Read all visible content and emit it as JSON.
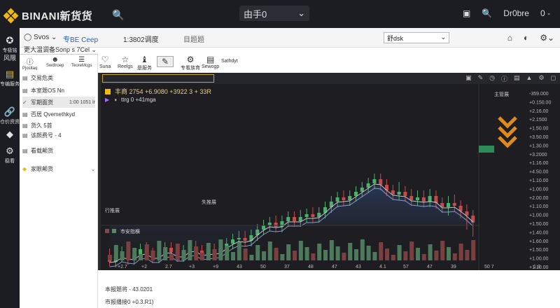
{
  "app": {
    "brand": "BINANI新货货",
    "search_icon": "search-icon",
    "center_select": "由手0",
    "right_items": [
      "Dr0bre",
      "0 -"
    ]
  },
  "rail": [
    {
      "label": "专极铭",
      "icon": "star-icon"
    },
    {
      "label": "风限",
      "icon": "chart-icon"
    },
    {
      "label": "专编服务",
      "icon": "book-icon"
    },
    {
      "label": "仓价资资",
      "icon": "link-icon"
    },
    {
      "label": "",
      "icon": "diamond-icon"
    },
    {
      "label": "稳看",
      "icon": "gear-icon"
    }
  ],
  "toolbar1": {
    "pair": "Svos",
    "market": "专BE Ceep",
    "stat1": "1:3802调度",
    "stat2": "目题题",
    "select_value": "舒dsk",
    "icons": [
      "home-icon",
      "theme-icon",
      "settings-icon",
      "chevron-down-icon"
    ]
  },
  "crumb": "更大温调备Sonp s 7Cel",
  "leftpanel": {
    "tabs": [
      "Pjosltaq",
      "Swdtroep",
      "TeoreMcgs"
    ],
    "items": [
      {
        "text": "交易危类",
        "value": ""
      },
      {
        "text": "本室题OS Nn",
        "value": ""
      },
      {
        "text": "军期面货",
        "value": "1:00 1051 lr"
      },
      {
        "text": "否居 Qvemethkyd",
        "value": ""
      },
      {
        "text": "货久 5首",
        "value": ""
      },
      {
        "text": "该颜费号 - 4",
        "value": ""
      },
      {
        "text": "看载颠货",
        "value": ""
      },
      {
        "text": "家眼颠货",
        "value": ""
      }
    ]
  },
  "toolbar2": [
    "Suna",
    "Reelgs",
    "是服务",
    "",
    "专看族育",
    "Sewogp",
    "Sathdyt"
  ],
  "chart": {
    "legend1": "丰商 2754 +6.9080 +3922 3 + 33R",
    "legend2": "ttrg 0 +41mga",
    "annotation1": "行推展",
    "annotation2": "失推展",
    "volume_label": "市安指横",
    "side_header": "主管展",
    "price_labels": [
      "-359.000",
      "+0.150.00",
      "+2.16.00",
      "+2.1500",
      "+1.50.00",
      "+3.50.00",
      "+1.30.00",
      "+3.2000",
      "+1.16.00",
      "+4.50.00",
      "+1.10.00",
      "+1.00.00",
      "+2.00.00",
      "+1.10.00",
      "+1.00.00",
      "+1.50.00",
      "+1.40.00",
      "+1.60.00",
      "+1.50.00",
      "+1.00.00",
      "+1.10.00"
    ],
    "x_labels": [
      "+2.7",
      "+2",
      "2.7",
      "+3",
      "+9",
      "43",
      "50",
      "37",
      "48",
      "47",
      "43",
      "4.1",
      "57",
      "47",
      "39"
    ],
    "x_right": [
      "50 7",
      "1 3"
    ]
  },
  "below": {
    "line1": "本报题将 - 43.0201",
    "line2": "市报播接0 +0.3.R1)"
  },
  "chart_data": {
    "type": "candlestick",
    "series": [
      {
        "values": [
          [
            264,
            270,
            255,
            272
          ],
          [
            270,
            262,
            260,
            274
          ],
          [
            262,
            258,
            252,
            266
          ],
          [
            258,
            266,
            254,
            270
          ],
          [
            266,
            260,
            256,
            270
          ],
          [
            260,
            252,
            248,
            264
          ],
          [
            252,
            258,
            246,
            262
          ],
          [
            258,
            264,
            254,
            268
          ],
          [
            264,
            258,
            254,
            268
          ],
          [
            258,
            250,
            246,
            262
          ],
          [
            250,
            256,
            246,
            260
          ],
          [
            256,
            262,
            252,
            266
          ],
          [
            262,
            256,
            250,
            266
          ],
          [
            256,
            248,
            244,
            260
          ],
          [
            248,
            254,
            244,
            258
          ],
          [
            254,
            260,
            250,
            264
          ],
          [
            260,
            252,
            248,
            264
          ],
          [
            252,
            258,
            248,
            262
          ],
          [
            258,
            250,
            246,
            262
          ],
          [
            250,
            244,
            240,
            254
          ],
          [
            244,
            238,
            234,
            248
          ],
          [
            238,
            236,
            230,
            242
          ],
          [
            236,
            240,
            230,
            244
          ],
          [
            240,
            232,
            228,
            244
          ],
          [
            232,
            224,
            220,
            236
          ],
          [
            224,
            218,
            214,
            228
          ],
          [
            218,
            214,
            210,
            222
          ],
          [
            214,
            220,
            208,
            224
          ],
          [
            220,
            212,
            208,
            224
          ],
          [
            212,
            206,
            202,
            216
          ],
          [
            206,
            212,
            202,
            216
          ],
          [
            212,
            206,
            200,
            216
          ],
          [
            206,
            202,
            198,
            210
          ],
          [
            202,
            206,
            196,
            210
          ],
          [
            206,
            200,
            196,
            210
          ],
          [
            200,
            192,
            188,
            204
          ],
          [
            192,
            184,
            180,
            196
          ],
          [
            184,
            178,
            174,
            188
          ],
          [
            178,
            182,
            172,
            186
          ],
          [
            182,
            176,
            172,
            186
          ],
          [
            176,
            170,
            166,
            180
          ],
          [
            170,
            164,
            160,
            174
          ],
          [
            164,
            158,
            154,
            168
          ],
          [
            158,
            152,
            148,
            162
          ],
          [
            152,
            160,
            148,
            164
          ],
          [
            160,
            168,
            156,
            172
          ],
          [
            168,
            174,
            164,
            178
          ],
          [
            174,
            170,
            160,
            178
          ],
          [
            170,
            176,
            166,
            180
          ],
          [
            176,
            182,
            170,
            186
          ],
          [
            182,
            178,
            172,
            186
          ],
          [
            178,
            184,
            172,
            188
          ],
          [
            184,
            176,
            170,
            188
          ],
          [
            176,
            186,
            172,
            190
          ],
          [
            186,
            192,
            182,
            196
          ],
          [
            192,
            186,
            180,
            200
          ],
          [
            186,
            190,
            178,
            194
          ],
          [
            190,
            198,
            186,
            204
          ],
          [
            198,
            204,
            192,
            220
          ],
          [
            204,
            214,
            200,
            230
          ]
        ]
      }
    ]
  }
}
